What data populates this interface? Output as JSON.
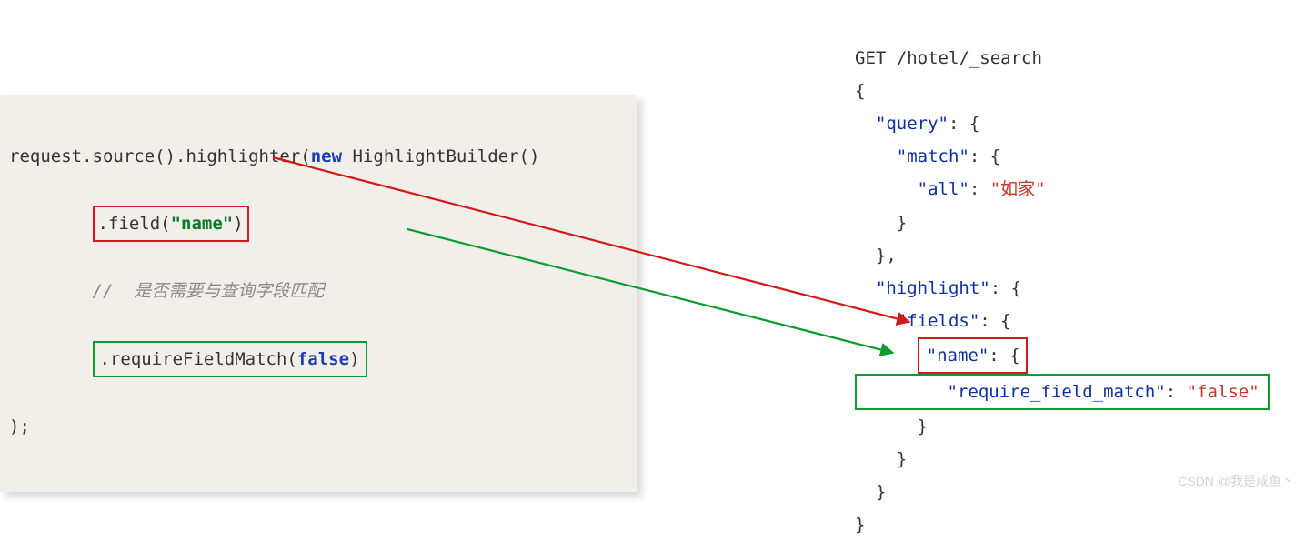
{
  "left": {
    "line1_pre": "request.source().highlighter(",
    "line1_new": "new",
    "line1_post": " HighlightBuilder()",
    "field_call_pre": ".field(",
    "field_call_arg": "\"name\"",
    "field_call_post": ")",
    "comment": "//  是否需要与查询字段匹配",
    "rfm_pre": ".requireFieldMatch(",
    "rfm_arg": "false",
    "rfm_post": ")",
    "close": ");"
  },
  "right": {
    "request_line": "GET /hotel/_search",
    "brace_open": "{",
    "query_key": "\"query\"",
    "match_key": "\"match\"",
    "all_key": "\"all\"",
    "all_val": "\"如家\"",
    "highlight_key": "\"highlight\"",
    "fields_key": "\"fields\"",
    "name_key": "\"name\"",
    "rfm_key": "\"require_field_match\"",
    "rfm_val": "\"false\"",
    "brace_close": "}",
    "colon_brace": ": {",
    "colon_space": ": ",
    "close_comma": "},"
  },
  "watermark": "CSDN @我是咸鱼丶"
}
